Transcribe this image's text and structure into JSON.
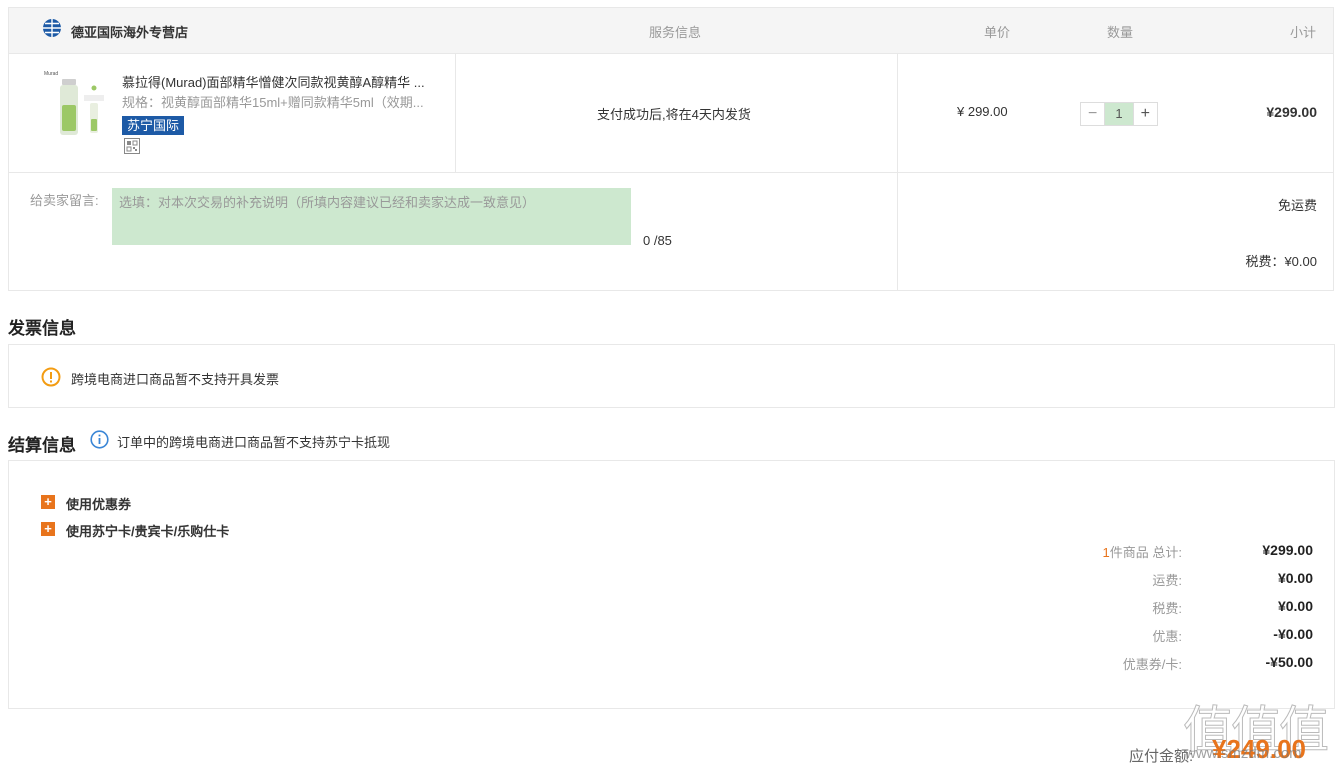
{
  "order": {
    "store_name": "德亚国际海外专营店",
    "headers": {
      "service": "服务信息",
      "unit_price": "单价",
      "quantity": "数量",
      "subtotal": "小计"
    },
    "product": {
      "title": "慕拉得(Murad)面部精华憎健次同款视黄醇A醇精华 ...",
      "spec": "规格：视黄醇面部精华15ml+赠同款精华5ml（效期...",
      "badge": "苏宁国际",
      "service": "支付成功后,将在4天内发货",
      "unit_price": "¥ 299.00",
      "quantity": "1",
      "qty_minus": "−",
      "qty_plus": "+",
      "subtotal": "¥299.00"
    },
    "message": {
      "label": "给卖家留言:",
      "placeholder": "选填：对本次交易的补充说明（所填内容建议已经和卖家达成一致意见）",
      "count": "0 /85"
    },
    "shipping": "免运费",
    "tax": "税费：¥0.00"
  },
  "invoice": {
    "title": "发票信息",
    "notice": "跨境电商进口商品暂不支持开具发票"
  },
  "settlement": {
    "title": "结算信息",
    "note": "订单中的跨境电商进口商品暂不支持苏宁卡抵现",
    "options": [
      "使用优惠券",
      "使用苏宁卡/贵宾卡/乐购仕卡"
    ],
    "summary": {
      "count": "1",
      "count_label": "件商品 总计:",
      "items_total": "¥299.00",
      "shipping_label": "运费:",
      "shipping": "¥0.00",
      "tax_label": "税费:",
      "tax": "¥0.00",
      "discount_label": "优惠:",
      "discount": "-¥0.00",
      "coupon_label": "优惠券/卡:",
      "coupon": "-¥50.00"
    },
    "pay_label": "应付金额:",
    "pay_total": "¥249.00"
  },
  "watermark": {
    "text": "值值值",
    "url": "www.smzdm.com"
  },
  "colors": {
    "accent": "#e8741c",
    "brand_blue": "#1d5aa6",
    "input_fill": "#cde8cf"
  }
}
